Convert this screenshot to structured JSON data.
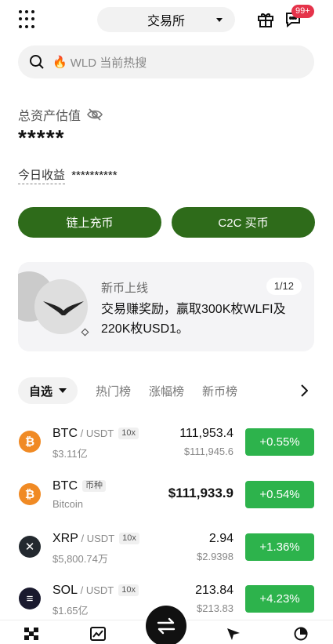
{
  "header": {
    "mode_label": "交易所",
    "badge": "99+"
  },
  "search": {
    "placeholder": "WLD 当前热搜"
  },
  "assets": {
    "label": "总资产估值",
    "value": "*****",
    "today_label": "今日收益",
    "today_value": "**********"
  },
  "actions": {
    "onchain_deposit": "链上充币",
    "c2c_buy": "C2C 买币"
  },
  "banner": {
    "title": "新币上线",
    "pager": "1/12",
    "text": "交易赚奖励，赢取300K枚WLFI及220K枚USD1。"
  },
  "tabs": {
    "active": "自选",
    "items": [
      "热门榜",
      "涨幅榜",
      "新币榜"
    ]
  },
  "markets": [
    {
      "symbol": "BTC",
      "pair": " / USDT",
      "tag": "10x",
      "sub": "$3.11亿",
      "price": "111,953.4",
      "fiat": "$111,945.6",
      "change": "+0.55%",
      "icon_char": "₿",
      "icon_color": "#f08a24"
    },
    {
      "symbol": "BTC",
      "pair": "",
      "tag": "币种",
      "sub": "Bitcoin",
      "price": "$111,933.9",
      "fiat": "",
      "change": "+0.54%",
      "icon_char": "₿",
      "icon_color": "#f08a24"
    },
    {
      "symbol": "XRP",
      "pair": " / USDT",
      "tag": "10x",
      "sub": "$5,800.74万",
      "price": "2.94",
      "fiat": "$2.9398",
      "change": "+1.36%",
      "icon_char": "✕",
      "icon_color": "#23292f"
    },
    {
      "symbol": "SOL",
      "pair": " / USDT",
      "tag": "10x",
      "sub": "$1.65亿",
      "price": "213.84",
      "fiat": "$213.83",
      "change": "+4.23%",
      "icon_char": "≡",
      "icon_color": "#1a1a2e"
    }
  ],
  "colors": {
    "brand_green": "#2e6b1a",
    "up_green": "#2db34c",
    "badge_red": "#e5334a"
  }
}
